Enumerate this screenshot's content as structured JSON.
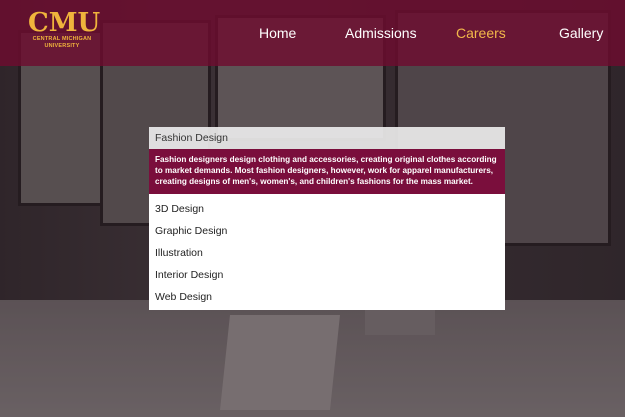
{
  "brand": {
    "name": "CMU",
    "subtitle_line1": "CENTRAL MICHIGAN",
    "subtitle_line2": "UNIVERSITY",
    "color": "#f0b43c"
  },
  "nav": {
    "items": [
      {
        "label": "Home",
        "active": false
      },
      {
        "label": "Admissions",
        "active": false
      },
      {
        "label": "Careers",
        "active": true
      },
      {
        "label": "Gallery",
        "active": false
      }
    ],
    "active_color": "#f2b84a",
    "bar_color": "#6e0c30"
  },
  "program": {
    "title": "Fashion Design",
    "description": "Fashion designers design clothing and accessories, creating original clothes according to market demands. Most fashion designers, however, work for apparel manufacturers, creating designs of men's, women's, and children's fashions for the mass market.",
    "accent_color": "#7a0e3c"
  },
  "related": [
    {
      "label": "3D Design"
    },
    {
      "label": "Graphic Design"
    },
    {
      "label": "Illustration"
    },
    {
      "label": "Interior Design"
    },
    {
      "label": "Web Design"
    }
  ]
}
